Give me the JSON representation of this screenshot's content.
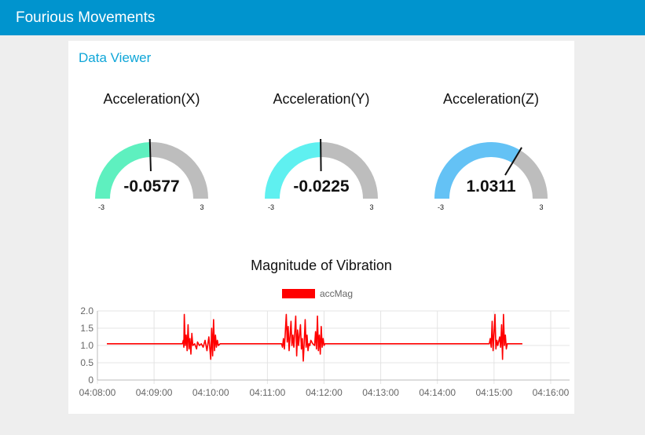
{
  "app": {
    "title": "Fourious Movements"
  },
  "panel": {
    "title": "Data Viewer"
  },
  "gauges": [
    {
      "title": "Acceleration(X)",
      "value": -0.0577,
      "value_text": "-0.0577",
      "min": -3,
      "max": 3,
      "min_label": "-3",
      "max_label": "3",
      "color": "#5ef0bf"
    },
    {
      "title": "Acceleration(Y)",
      "value": -0.0225,
      "value_text": "-0.0225",
      "min": -3,
      "max": 3,
      "min_label": "-3",
      "max_label": "3",
      "color": "#5ff0f0"
    },
    {
      "title": "Acceleration(Z)",
      "value": 1.0311,
      "value_text": "1.0311",
      "min": -3,
      "max": 3,
      "min_label": "-3",
      "max_label": "3",
      "color": "#64c2f5"
    }
  ],
  "colors": {
    "header": "#0094ce",
    "accent": "#0fa6d8",
    "gauge_track": "#bdbdbd",
    "series": "#ff0000"
  },
  "chart_data": {
    "type": "line",
    "title": "Magnitude of Vibration",
    "xlabel": "",
    "ylabel": "",
    "ylim": [
      0,
      2
    ],
    "yticks": [
      "0",
      "0.5",
      "1.0",
      "1.5",
      "2.0"
    ],
    "xticks": [
      "04:08:00",
      "04:09:00",
      "04:10:00",
      "04:11:00",
      "04:12:00",
      "04:13:00",
      "04:14:00",
      "04:15:00",
      "04:16:00"
    ],
    "xlim": [
      "04:08:00",
      "04:16:20"
    ],
    "grid": true,
    "legend": "top-center",
    "series": [
      {
        "name": "accMag",
        "color": "#ff0000",
        "points": [
          [
            "04:08:10",
            1.05
          ],
          [
            "04:09:30",
            1.05
          ],
          [
            "04:09:31",
            1.15
          ],
          [
            "04:09:31.5",
            0.95
          ],
          [
            "04:09:32",
            1.9
          ],
          [
            "04:09:33",
            1.0
          ],
          [
            "04:09:34",
            1.3
          ],
          [
            "04:09:35",
            0.85
          ],
          [
            "04:09:36",
            1.6
          ],
          [
            "04:09:37",
            0.9
          ],
          [
            "04:09:38",
            1.2
          ],
          [
            "04:09:39",
            0.75
          ],
          [
            "04:09:40",
            1.35
          ],
          [
            "04:09:41",
            1.0
          ],
          [
            "04:09:43",
            1.05
          ],
          [
            "04:09:45",
            0.9
          ],
          [
            "04:09:46",
            1.1
          ],
          [
            "04:09:48",
            1.0
          ],
          [
            "04:09:50",
            1.05
          ],
          [
            "04:09:52",
            0.95
          ],
          [
            "04:09:54",
            1.15
          ],
          [
            "04:09:56",
            0.85
          ],
          [
            "04:09:58",
            1.25
          ],
          [
            "04:10:00",
            0.6
          ],
          [
            "04:10:01",
            1.5
          ],
          [
            "04:10:02",
            0.7
          ],
          [
            "04:10:03",
            1.75
          ],
          [
            "04:10:04",
            0.85
          ],
          [
            "04:10:05",
            1.3
          ],
          [
            "04:10:06",
            0.95
          ],
          [
            "04:10:07",
            1.15
          ],
          [
            "04:10:08",
            1.0
          ],
          [
            "04:10:10",
            1.05
          ],
          [
            "04:10:40",
            1.05
          ],
          [
            "04:10:42",
            1.05
          ],
          [
            "04:10:50",
            1.05
          ],
          [
            "04:11:15",
            1.05
          ],
          [
            "04:11:16",
            0.95
          ],
          [
            "04:11:17",
            1.2
          ],
          [
            "04:11:18",
            0.9
          ],
          [
            "04:11:20",
            1.9
          ],
          [
            "04:11:21",
            1.1
          ],
          [
            "04:11:22",
            1.55
          ],
          [
            "04:11:23",
            0.85
          ],
          [
            "04:11:25",
            1.7
          ],
          [
            "04:11:26",
            1.0
          ],
          [
            "04:11:27",
            1.3
          ],
          [
            "04:11:28",
            0.95
          ],
          [
            "04:11:30",
            1.85
          ],
          [
            "04:11:31",
            0.7
          ],
          [
            "04:11:32",
            1.45
          ],
          [
            "04:11:33",
            1.0
          ],
          [
            "04:11:35",
            1.6
          ],
          [
            "04:11:36",
            0.9
          ],
          [
            "04:11:37",
            1.2
          ],
          [
            "04:11:38",
            0.55
          ],
          [
            "04:11:39",
            1.1
          ],
          [
            "04:11:40",
            1.75
          ],
          [
            "04:11:41",
            0.95
          ],
          [
            "04:11:42",
            1.3
          ],
          [
            "04:11:43",
            0.85
          ],
          [
            "04:11:44",
            1.05
          ],
          [
            "04:11:45",
            1.0
          ],
          [
            "04:11:46",
            1.15
          ],
          [
            "04:11:48",
            1.05
          ],
          [
            "04:11:50",
            1.0
          ],
          [
            "04:11:51",
            1.4
          ],
          [
            "04:11:52",
            0.9
          ],
          [
            "04:11:53",
            1.85
          ],
          [
            "04:11:54",
            0.85
          ],
          [
            "04:11:55",
            1.3
          ],
          [
            "04:11:56",
            0.75
          ],
          [
            "04:11:57",
            1.55
          ],
          [
            "04:11:58",
            0.95
          ],
          [
            "04:11:59",
            1.2
          ],
          [
            "04:12:00",
            1.0
          ],
          [
            "04:12:01",
            1.05
          ],
          [
            "04:14:55",
            1.05
          ],
          [
            "04:14:56",
            1.2
          ],
          [
            "04:14:57",
            0.95
          ],
          [
            "04:14:58",
            1.7
          ],
          [
            "04:14:59",
            0.85
          ],
          [
            "04:15:00",
            1.35
          ],
          [
            "04:15:01",
            1.9
          ],
          [
            "04:15:02",
            0.9
          ],
          [
            "04:15:03",
            1.15
          ],
          [
            "04:15:04",
            1.0
          ],
          [
            "04:15:06",
            1.25
          ],
          [
            "04:15:07",
            0.95
          ],
          [
            "04:15:08",
            1.6
          ],
          [
            "04:15:09",
            0.6
          ],
          [
            "04:15:10",
            1.9
          ],
          [
            "04:15:11",
            1.0
          ],
          [
            "04:15:12",
            1.3
          ],
          [
            "04:15:13",
            0.9
          ],
          [
            "04:15:14",
            1.05
          ],
          [
            "04:15:30",
            1.05
          ]
        ]
      }
    ]
  }
}
